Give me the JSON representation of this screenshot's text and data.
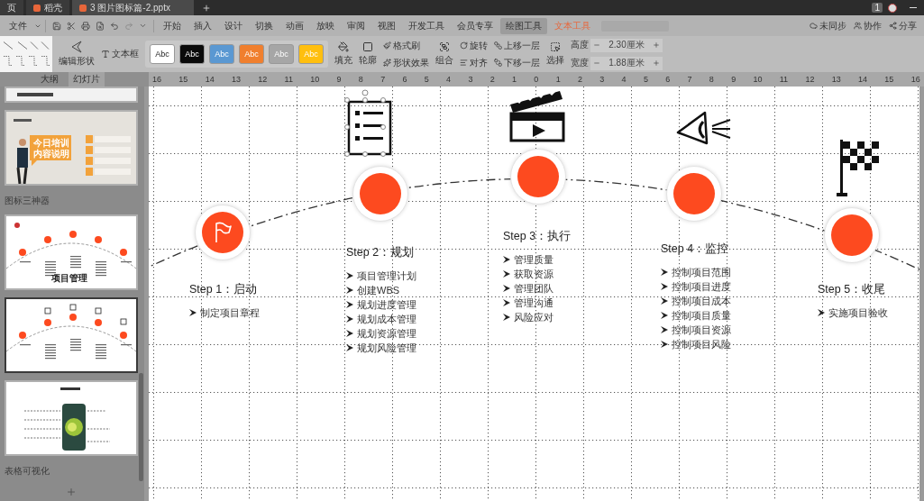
{
  "title_bar": {
    "tabs": [
      {
        "label": "页",
        "selected": false,
        "kind": "plain"
      },
      {
        "label": "稻壳",
        "selected": false,
        "kind": "app"
      },
      {
        "label": "3 图片图标篇-2.pptx",
        "selected": true,
        "kind": "file"
      }
    ],
    "badge": "1"
  },
  "menu": {
    "file": "文件",
    "items": [
      {
        "label": "开始",
        "selected": false,
        "kind": "tab"
      },
      {
        "label": "插入",
        "selected": false,
        "kind": "tab"
      },
      {
        "label": "设计",
        "selected": false,
        "kind": "tab"
      },
      {
        "label": "切换",
        "selected": false,
        "kind": "tab"
      },
      {
        "label": "动画",
        "selected": false,
        "kind": "tab"
      },
      {
        "label": "放映",
        "selected": false,
        "kind": "tab"
      },
      {
        "label": "审阅",
        "selected": false,
        "kind": "tab"
      },
      {
        "label": "视图",
        "selected": false,
        "kind": "tab"
      },
      {
        "label": "开发工具",
        "selected": false,
        "kind": "tab"
      },
      {
        "label": "会员专享",
        "selected": false,
        "kind": "tab"
      },
      {
        "label": "绘图工具",
        "selected": true,
        "kind": "tab"
      },
      {
        "label": "文本工具",
        "selected": false,
        "kind": "contextual"
      }
    ],
    "right": {
      "sync": "未同步",
      "collab": "协作",
      "share": "分享"
    }
  },
  "ribbon": {
    "edit_shape": "编辑形状",
    "text_box": "文本框",
    "styles": [
      {
        "label": "Abc",
        "color": "#ffffff"
      },
      {
        "label": "Abc",
        "color": "#0a0a0a"
      },
      {
        "label": "Abc",
        "color": "#5a98d2"
      },
      {
        "label": "Abc",
        "color": "#f07f2e"
      },
      {
        "label": "Abc",
        "color": "#a6a6a6"
      },
      {
        "label": "Abc",
        "color": "#ffbf0f"
      }
    ],
    "fill": "填充",
    "outline": "轮廓",
    "format_painter": "格式刷",
    "shape_effects": "形状效果",
    "group": "组合",
    "rotate": "旋转",
    "align": "对齐",
    "bring_forward": "上移一层",
    "send_backward": "下移一层",
    "select": "选择",
    "height": {
      "label": "高度",
      "value": "2.30厘米"
    },
    "width": {
      "label": "宽度",
      "value": "1.88厘米"
    }
  },
  "panel": {
    "tabs": [
      {
        "label": "大纲",
        "selected": false
      },
      {
        "label": "幻灯片",
        "selected": true
      }
    ],
    "items": [
      {
        "kind": "partial",
        "selected": false
      },
      {
        "kind": "training",
        "selected": false,
        "title_lines": [
          "今日培训",
          "内容说明"
        ]
      },
      {
        "kind": "section",
        "label": "图标三神器"
      },
      {
        "kind": "timeline",
        "selected": false,
        "title": "项目管理"
      },
      {
        "kind": "timeline-icons",
        "selected": true
      },
      {
        "kind": "phone",
        "selected": false
      },
      {
        "kind": "section",
        "label": "表格可视化"
      }
    ]
  },
  "ruler": [
    "16",
    "15",
    "14",
    "13",
    "12",
    "11",
    "10",
    "9",
    "8",
    "7",
    "6",
    "5",
    "4",
    "3",
    "2",
    "1",
    "0",
    "1",
    "2",
    "3",
    "4",
    "5",
    "6",
    "7",
    "8",
    "9",
    "10",
    "11",
    "12",
    "13",
    "14",
    "15",
    "16"
  ],
  "slide": {
    "steps": [
      {
        "title": "Step 1：启动",
        "items": [
          "制定项目章程"
        ]
      },
      {
        "title": "Step 2：规划",
        "items": [
          "项目管理计划",
          "创建WBS",
          "规划进度管理",
          "规划成本管理",
          "规划资源管理",
          "规划风险管理"
        ]
      },
      {
        "title": "Step 3：执行",
        "items": [
          "管理质量",
          "获取资源",
          "管理团队",
          "管理沟通",
          "风险应对"
        ]
      },
      {
        "title": "Step 4：监控",
        "items": [
          "控制项目范围",
          "控制项目进度",
          "控制项目成本",
          "控制项目质量",
          "控制项目资源",
          "控制项目风险"
        ]
      },
      {
        "title": "Step 5：收尾",
        "items": [
          "实施项目验收"
        ]
      }
    ]
  }
}
